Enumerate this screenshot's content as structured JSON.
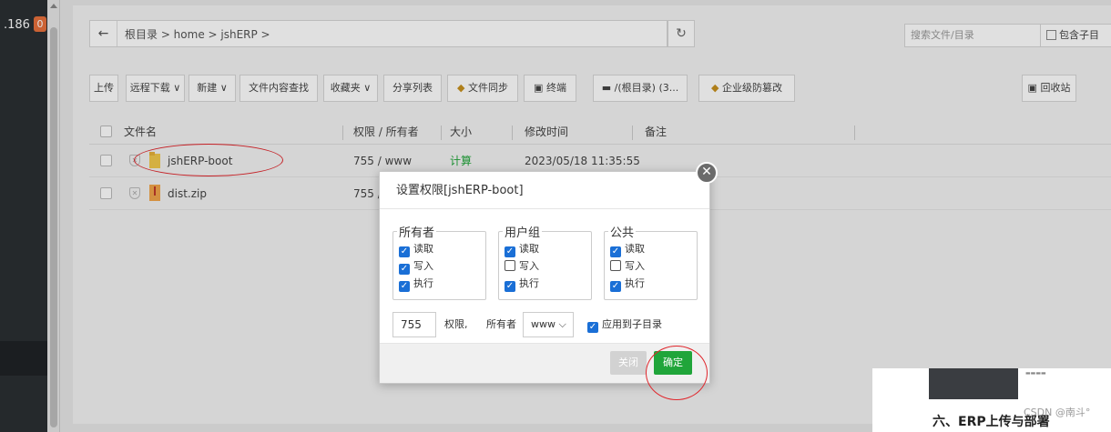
{
  "sidebar": {
    "ip_fragment": ".186",
    "badge": "0"
  },
  "path": {
    "back_icon": "arrow-left-icon",
    "crumbs": "根目录 > home > jshERP >",
    "refresh_icon": "refresh-icon"
  },
  "search": {
    "placeholder": "搜索文件/目录",
    "subdir_label": "包含子目"
  },
  "toolbar": {
    "upload": "上传",
    "remote_download": "远程下载 ∨",
    "new": "新建 ∨",
    "content_search": "文件内容查找",
    "favorites": "收藏夹 ∨",
    "share_list": "分享列表",
    "file_sync": "文件同步",
    "terminal": "终端",
    "disk": "/(根目录) (3...",
    "tamper": "企业级防篡改",
    "recycle": "回收站"
  },
  "table": {
    "headers": {
      "name": "文件名",
      "perm_owner": "权限 / 所有者",
      "size": "大小",
      "mtime": "修改时间",
      "note": "备注"
    },
    "rows": [
      {
        "name": "jshERP-boot",
        "perm": "755 / www",
        "size": "计算",
        "mtime": "2023/05/18 11:35:55"
      },
      {
        "name": "dist.zip",
        "perm": "755 /"
      }
    ]
  },
  "dialog": {
    "title": "设置权限[jshERP-boot]",
    "groups": [
      {
        "label": "所有者",
        "read": "读取",
        "write": "写入",
        "exec": "执行",
        "read_on": true,
        "write_on": true,
        "exec_on": true
      },
      {
        "label": "用户组",
        "read": "读取",
        "write": "写入",
        "exec": "执行",
        "read_on": true,
        "write_on": false,
        "exec_on": true
      },
      {
        "label": "公共",
        "read": "读取",
        "write": "写入",
        "exec": "执行",
        "read_on": true,
        "write_on": false,
        "exec_on": true
      }
    ],
    "perm_value": "755",
    "perm_label": "权限,",
    "owner_label": "所有者",
    "owner_value": "www",
    "apply_sub": "应用到子目录",
    "btn_close": "关闭",
    "btn_ok": "确定"
  },
  "preview": {
    "caption": "六、ERP上传与部署",
    "watermark": "CSDN @南斗°"
  },
  "colors": {
    "accent_green": "#20a53a",
    "checkbox_blue": "#1a6fd6",
    "annotation_red": "#e0262c",
    "sidebar_dark": "#2b2f33"
  }
}
